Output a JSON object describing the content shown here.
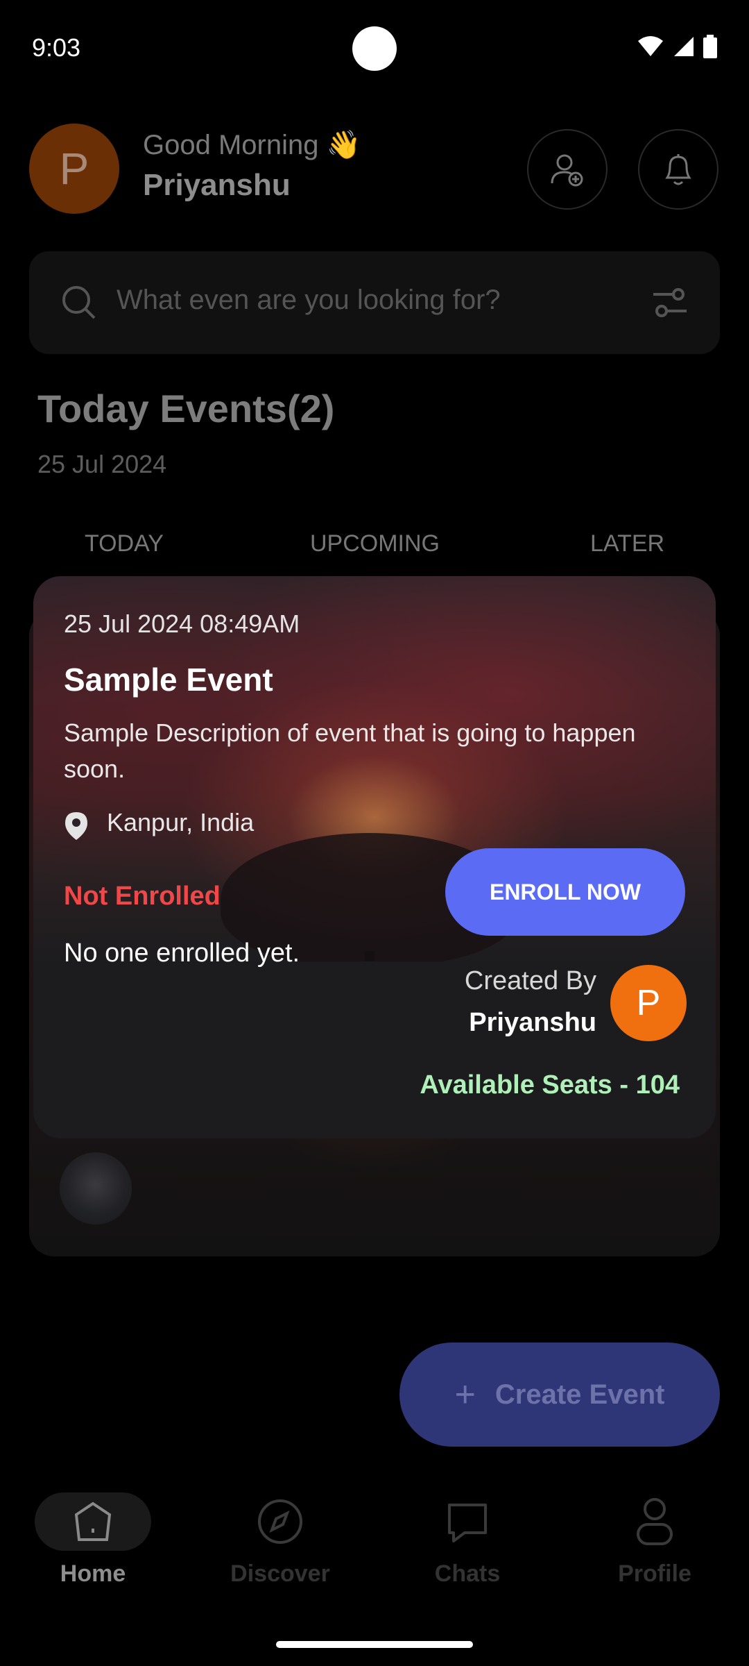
{
  "status_bar": {
    "time": "9:03"
  },
  "header": {
    "avatar_letter": "P",
    "greeting": "Good Morning 👋",
    "user_name": "Priyanshu"
  },
  "search": {
    "placeholder": "What even are you looking for?"
  },
  "section": {
    "title": "Today Events(2)",
    "date": "25 Jul 2024"
  },
  "tabs": [
    {
      "label": "TODAY"
    },
    {
      "label": "UPCOMING"
    },
    {
      "label": "LATER"
    }
  ],
  "event_card": {
    "datetime": "25 Jul 2024 08:49AM",
    "title": "Sample Event",
    "description": "Sample Description of event that is going to happen soon.",
    "location": "Kanpur, India",
    "enroll_status": "Not Enrolled",
    "enroll_button": "ENROLL NOW",
    "enrolled_text": "No one enrolled yet.",
    "created_by_label": "Created By",
    "creator_name": "Priyanshu",
    "creator_avatar_letter": "P",
    "seats": "Available Seats - 104"
  },
  "fab": {
    "label": "Create Event"
  },
  "bottom_nav": [
    {
      "label": "Home",
      "icon": "home-icon"
    },
    {
      "label": "Discover",
      "icon": "compass-icon"
    },
    {
      "label": "Chats",
      "icon": "chat-icon"
    },
    {
      "label": "Profile",
      "icon": "profile-icon"
    }
  ],
  "colors": {
    "accent": "#5b6bf4",
    "not_enrolled": "#f04848",
    "seats": "#aef0b8",
    "avatar": "#f07010"
  }
}
